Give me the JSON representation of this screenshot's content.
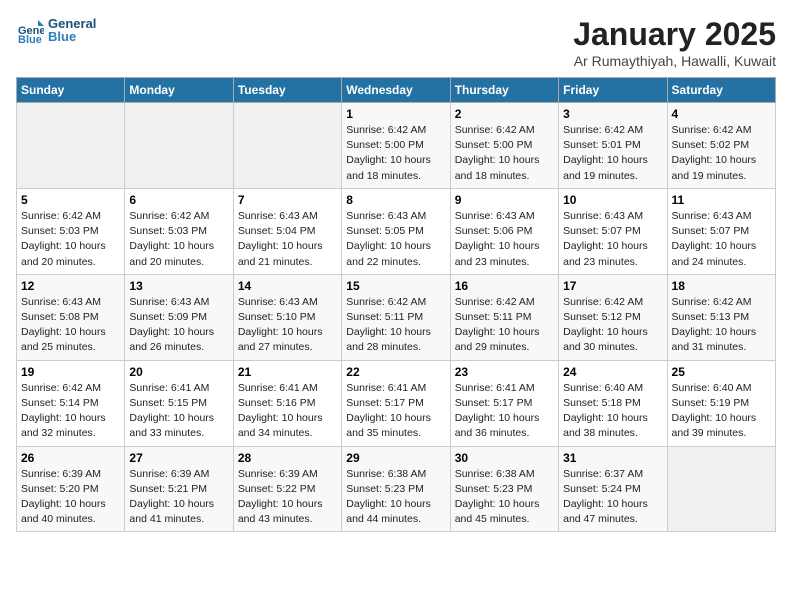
{
  "header": {
    "logo_line1": "General",
    "logo_line2": "Blue",
    "month": "January 2025",
    "location": "Ar Rumaythiyah, Hawalli, Kuwait"
  },
  "days_of_week": [
    "Sunday",
    "Monday",
    "Tuesday",
    "Wednesday",
    "Thursday",
    "Friday",
    "Saturday"
  ],
  "weeks": [
    [
      {
        "day": "",
        "info": ""
      },
      {
        "day": "",
        "info": ""
      },
      {
        "day": "",
        "info": ""
      },
      {
        "day": "1",
        "info": "Sunrise: 6:42 AM\nSunset: 5:00 PM\nDaylight: 10 hours\nand 18 minutes."
      },
      {
        "day": "2",
        "info": "Sunrise: 6:42 AM\nSunset: 5:00 PM\nDaylight: 10 hours\nand 18 minutes."
      },
      {
        "day": "3",
        "info": "Sunrise: 6:42 AM\nSunset: 5:01 PM\nDaylight: 10 hours\nand 19 minutes."
      },
      {
        "day": "4",
        "info": "Sunrise: 6:42 AM\nSunset: 5:02 PM\nDaylight: 10 hours\nand 19 minutes."
      }
    ],
    [
      {
        "day": "5",
        "info": "Sunrise: 6:42 AM\nSunset: 5:03 PM\nDaylight: 10 hours\nand 20 minutes."
      },
      {
        "day": "6",
        "info": "Sunrise: 6:42 AM\nSunset: 5:03 PM\nDaylight: 10 hours\nand 20 minutes."
      },
      {
        "day": "7",
        "info": "Sunrise: 6:43 AM\nSunset: 5:04 PM\nDaylight: 10 hours\nand 21 minutes."
      },
      {
        "day": "8",
        "info": "Sunrise: 6:43 AM\nSunset: 5:05 PM\nDaylight: 10 hours\nand 22 minutes."
      },
      {
        "day": "9",
        "info": "Sunrise: 6:43 AM\nSunset: 5:06 PM\nDaylight: 10 hours\nand 23 minutes."
      },
      {
        "day": "10",
        "info": "Sunrise: 6:43 AM\nSunset: 5:07 PM\nDaylight: 10 hours\nand 23 minutes."
      },
      {
        "day": "11",
        "info": "Sunrise: 6:43 AM\nSunset: 5:07 PM\nDaylight: 10 hours\nand 24 minutes."
      }
    ],
    [
      {
        "day": "12",
        "info": "Sunrise: 6:43 AM\nSunset: 5:08 PM\nDaylight: 10 hours\nand 25 minutes."
      },
      {
        "day": "13",
        "info": "Sunrise: 6:43 AM\nSunset: 5:09 PM\nDaylight: 10 hours\nand 26 minutes."
      },
      {
        "day": "14",
        "info": "Sunrise: 6:43 AM\nSunset: 5:10 PM\nDaylight: 10 hours\nand 27 minutes."
      },
      {
        "day": "15",
        "info": "Sunrise: 6:42 AM\nSunset: 5:11 PM\nDaylight: 10 hours\nand 28 minutes."
      },
      {
        "day": "16",
        "info": "Sunrise: 6:42 AM\nSunset: 5:11 PM\nDaylight: 10 hours\nand 29 minutes."
      },
      {
        "day": "17",
        "info": "Sunrise: 6:42 AM\nSunset: 5:12 PM\nDaylight: 10 hours\nand 30 minutes."
      },
      {
        "day": "18",
        "info": "Sunrise: 6:42 AM\nSunset: 5:13 PM\nDaylight: 10 hours\nand 31 minutes."
      }
    ],
    [
      {
        "day": "19",
        "info": "Sunrise: 6:42 AM\nSunset: 5:14 PM\nDaylight: 10 hours\nand 32 minutes."
      },
      {
        "day": "20",
        "info": "Sunrise: 6:41 AM\nSunset: 5:15 PM\nDaylight: 10 hours\nand 33 minutes."
      },
      {
        "day": "21",
        "info": "Sunrise: 6:41 AM\nSunset: 5:16 PM\nDaylight: 10 hours\nand 34 minutes."
      },
      {
        "day": "22",
        "info": "Sunrise: 6:41 AM\nSunset: 5:17 PM\nDaylight: 10 hours\nand 35 minutes."
      },
      {
        "day": "23",
        "info": "Sunrise: 6:41 AM\nSunset: 5:17 PM\nDaylight: 10 hours\nand 36 minutes."
      },
      {
        "day": "24",
        "info": "Sunrise: 6:40 AM\nSunset: 5:18 PM\nDaylight: 10 hours\nand 38 minutes."
      },
      {
        "day": "25",
        "info": "Sunrise: 6:40 AM\nSunset: 5:19 PM\nDaylight: 10 hours\nand 39 minutes."
      }
    ],
    [
      {
        "day": "26",
        "info": "Sunrise: 6:39 AM\nSunset: 5:20 PM\nDaylight: 10 hours\nand 40 minutes."
      },
      {
        "day": "27",
        "info": "Sunrise: 6:39 AM\nSunset: 5:21 PM\nDaylight: 10 hours\nand 41 minutes."
      },
      {
        "day": "28",
        "info": "Sunrise: 6:39 AM\nSunset: 5:22 PM\nDaylight: 10 hours\nand 43 minutes."
      },
      {
        "day": "29",
        "info": "Sunrise: 6:38 AM\nSunset: 5:23 PM\nDaylight: 10 hours\nand 44 minutes."
      },
      {
        "day": "30",
        "info": "Sunrise: 6:38 AM\nSunset: 5:23 PM\nDaylight: 10 hours\nand 45 minutes."
      },
      {
        "day": "31",
        "info": "Sunrise: 6:37 AM\nSunset: 5:24 PM\nDaylight: 10 hours\nand 47 minutes."
      },
      {
        "day": "",
        "info": ""
      }
    ]
  ]
}
